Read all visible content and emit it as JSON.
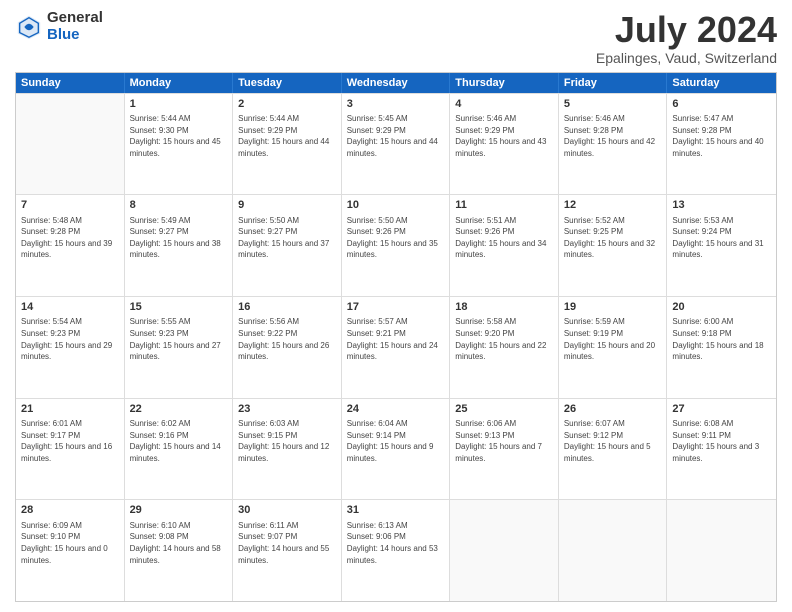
{
  "logo": {
    "general": "General",
    "blue": "Blue"
  },
  "title": {
    "month_year": "July 2024",
    "location": "Epalinges, Vaud, Switzerland"
  },
  "header_days": [
    "Sunday",
    "Monday",
    "Tuesday",
    "Wednesday",
    "Thursday",
    "Friday",
    "Saturday"
  ],
  "weeks": [
    [
      {
        "day": "",
        "sunrise": "",
        "sunset": "",
        "daylight": ""
      },
      {
        "day": "1",
        "sunrise": "Sunrise: 5:44 AM",
        "sunset": "Sunset: 9:30 PM",
        "daylight": "Daylight: 15 hours and 45 minutes."
      },
      {
        "day": "2",
        "sunrise": "Sunrise: 5:44 AM",
        "sunset": "Sunset: 9:29 PM",
        "daylight": "Daylight: 15 hours and 44 minutes."
      },
      {
        "day": "3",
        "sunrise": "Sunrise: 5:45 AM",
        "sunset": "Sunset: 9:29 PM",
        "daylight": "Daylight: 15 hours and 44 minutes."
      },
      {
        "day": "4",
        "sunrise": "Sunrise: 5:46 AM",
        "sunset": "Sunset: 9:29 PM",
        "daylight": "Daylight: 15 hours and 43 minutes."
      },
      {
        "day": "5",
        "sunrise": "Sunrise: 5:46 AM",
        "sunset": "Sunset: 9:28 PM",
        "daylight": "Daylight: 15 hours and 42 minutes."
      },
      {
        "day": "6",
        "sunrise": "Sunrise: 5:47 AM",
        "sunset": "Sunset: 9:28 PM",
        "daylight": "Daylight: 15 hours and 40 minutes."
      }
    ],
    [
      {
        "day": "7",
        "sunrise": "Sunrise: 5:48 AM",
        "sunset": "Sunset: 9:28 PM",
        "daylight": "Daylight: 15 hours and 39 minutes."
      },
      {
        "day": "8",
        "sunrise": "Sunrise: 5:49 AM",
        "sunset": "Sunset: 9:27 PM",
        "daylight": "Daylight: 15 hours and 38 minutes."
      },
      {
        "day": "9",
        "sunrise": "Sunrise: 5:50 AM",
        "sunset": "Sunset: 9:27 PM",
        "daylight": "Daylight: 15 hours and 37 minutes."
      },
      {
        "day": "10",
        "sunrise": "Sunrise: 5:50 AM",
        "sunset": "Sunset: 9:26 PM",
        "daylight": "Daylight: 15 hours and 35 minutes."
      },
      {
        "day": "11",
        "sunrise": "Sunrise: 5:51 AM",
        "sunset": "Sunset: 9:26 PM",
        "daylight": "Daylight: 15 hours and 34 minutes."
      },
      {
        "day": "12",
        "sunrise": "Sunrise: 5:52 AM",
        "sunset": "Sunset: 9:25 PM",
        "daylight": "Daylight: 15 hours and 32 minutes."
      },
      {
        "day": "13",
        "sunrise": "Sunrise: 5:53 AM",
        "sunset": "Sunset: 9:24 PM",
        "daylight": "Daylight: 15 hours and 31 minutes."
      }
    ],
    [
      {
        "day": "14",
        "sunrise": "Sunrise: 5:54 AM",
        "sunset": "Sunset: 9:23 PM",
        "daylight": "Daylight: 15 hours and 29 minutes."
      },
      {
        "day": "15",
        "sunrise": "Sunrise: 5:55 AM",
        "sunset": "Sunset: 9:23 PM",
        "daylight": "Daylight: 15 hours and 27 minutes."
      },
      {
        "day": "16",
        "sunrise": "Sunrise: 5:56 AM",
        "sunset": "Sunset: 9:22 PM",
        "daylight": "Daylight: 15 hours and 26 minutes."
      },
      {
        "day": "17",
        "sunrise": "Sunrise: 5:57 AM",
        "sunset": "Sunset: 9:21 PM",
        "daylight": "Daylight: 15 hours and 24 minutes."
      },
      {
        "day": "18",
        "sunrise": "Sunrise: 5:58 AM",
        "sunset": "Sunset: 9:20 PM",
        "daylight": "Daylight: 15 hours and 22 minutes."
      },
      {
        "day": "19",
        "sunrise": "Sunrise: 5:59 AM",
        "sunset": "Sunset: 9:19 PM",
        "daylight": "Daylight: 15 hours and 20 minutes."
      },
      {
        "day": "20",
        "sunrise": "Sunrise: 6:00 AM",
        "sunset": "Sunset: 9:18 PM",
        "daylight": "Daylight: 15 hours and 18 minutes."
      }
    ],
    [
      {
        "day": "21",
        "sunrise": "Sunrise: 6:01 AM",
        "sunset": "Sunset: 9:17 PM",
        "daylight": "Daylight: 15 hours and 16 minutes."
      },
      {
        "day": "22",
        "sunrise": "Sunrise: 6:02 AM",
        "sunset": "Sunset: 9:16 PM",
        "daylight": "Daylight: 15 hours and 14 minutes."
      },
      {
        "day": "23",
        "sunrise": "Sunrise: 6:03 AM",
        "sunset": "Sunset: 9:15 PM",
        "daylight": "Daylight: 15 hours and 12 minutes."
      },
      {
        "day": "24",
        "sunrise": "Sunrise: 6:04 AM",
        "sunset": "Sunset: 9:14 PM",
        "daylight": "Daylight: 15 hours and 9 minutes."
      },
      {
        "day": "25",
        "sunrise": "Sunrise: 6:06 AM",
        "sunset": "Sunset: 9:13 PM",
        "daylight": "Daylight: 15 hours and 7 minutes."
      },
      {
        "day": "26",
        "sunrise": "Sunrise: 6:07 AM",
        "sunset": "Sunset: 9:12 PM",
        "daylight": "Daylight: 15 hours and 5 minutes."
      },
      {
        "day": "27",
        "sunrise": "Sunrise: 6:08 AM",
        "sunset": "Sunset: 9:11 PM",
        "daylight": "Daylight: 15 hours and 3 minutes."
      }
    ],
    [
      {
        "day": "28",
        "sunrise": "Sunrise: 6:09 AM",
        "sunset": "Sunset: 9:10 PM",
        "daylight": "Daylight: 15 hours and 0 minutes."
      },
      {
        "day": "29",
        "sunrise": "Sunrise: 6:10 AM",
        "sunset": "Sunset: 9:08 PM",
        "daylight": "Daylight: 14 hours and 58 minutes."
      },
      {
        "day": "30",
        "sunrise": "Sunrise: 6:11 AM",
        "sunset": "Sunset: 9:07 PM",
        "daylight": "Daylight: 14 hours and 55 minutes."
      },
      {
        "day": "31",
        "sunrise": "Sunrise: 6:13 AM",
        "sunset": "Sunset: 9:06 PM",
        "daylight": "Daylight: 14 hours and 53 minutes."
      },
      {
        "day": "",
        "sunrise": "",
        "sunset": "",
        "daylight": ""
      },
      {
        "day": "",
        "sunrise": "",
        "sunset": "",
        "daylight": ""
      },
      {
        "day": "",
        "sunrise": "",
        "sunset": "",
        "daylight": ""
      }
    ]
  ]
}
